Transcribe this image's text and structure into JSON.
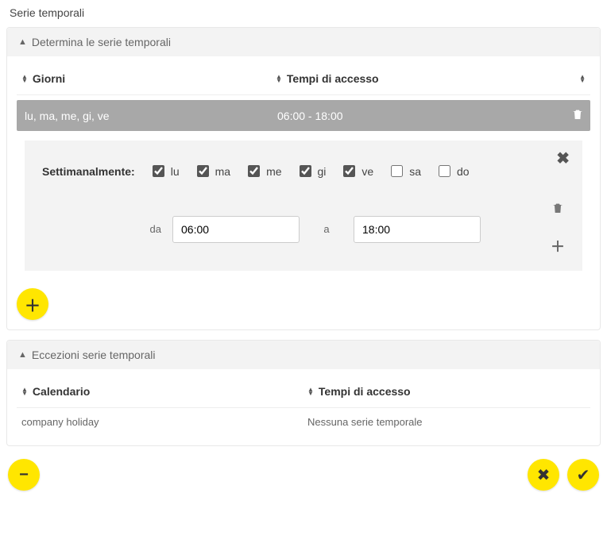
{
  "page_title": "Serie temporali",
  "panel1": {
    "title": "Determina le serie temporali",
    "columns": {
      "days": "Giorni",
      "times": "Tempi di accesso"
    },
    "selected_row": {
      "days": "lu, ma, me, gi, ve",
      "times": "06:00 - 18:00"
    },
    "editor": {
      "weekly_label": "Settimanalmente:",
      "days": [
        {
          "code": "lu",
          "checked": true
        },
        {
          "code": "ma",
          "checked": true
        },
        {
          "code": "me",
          "checked": true
        },
        {
          "code": "gi",
          "checked": true
        },
        {
          "code": "ve",
          "checked": true
        },
        {
          "code": "sa",
          "checked": false
        },
        {
          "code": "do",
          "checked": false
        }
      ],
      "from_label": "da",
      "from_value": "06:00",
      "to_label": "a",
      "to_value": "18:00"
    }
  },
  "panel2": {
    "title": "Eccezioni serie temporali",
    "columns": {
      "calendar": "Calendario",
      "times": "Tempi di accesso"
    },
    "rows": [
      {
        "calendar": "company holiday",
        "times": "Nessuna serie temporale"
      }
    ]
  }
}
